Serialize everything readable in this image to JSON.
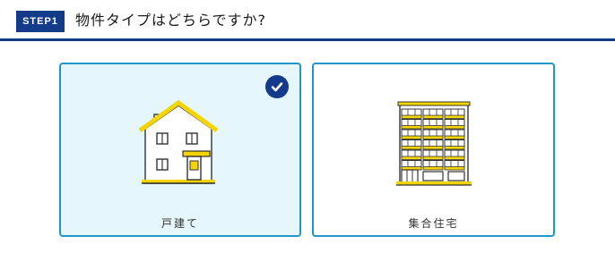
{
  "header": {
    "step_badge": "STEP1",
    "title": "物件タイプはどちらですか?"
  },
  "options": [
    {
      "label": "戸建て",
      "icon": "house-icon",
      "selected": true
    },
    {
      "label": "集合住宅",
      "icon": "apartment-building-icon",
      "selected": false
    }
  ],
  "colors": {
    "navy": "#143a8a",
    "border": "#1e96c8",
    "selected_bg": "#e6f6fd",
    "icon_yellow": "#f5d400"
  }
}
